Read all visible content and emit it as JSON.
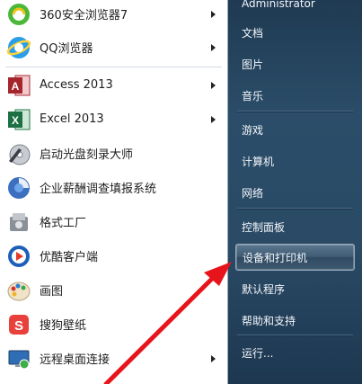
{
  "start_menu": {
    "programs": [
      {
        "label": "360安全浏览器7",
        "icon": "360-browser-icon",
        "has_arrow": true
      },
      {
        "label": "QQ浏览器",
        "icon": "qq-browser-icon",
        "has_arrow": true
      },
      {
        "label": "Access 2013",
        "icon": "access-icon",
        "has_arrow": true
      },
      {
        "label": "Excel 2013",
        "icon": "excel-icon",
        "has_arrow": true
      },
      {
        "label": "启动光盘刻录大师",
        "icon": "disc-burner-icon",
        "has_arrow": false
      },
      {
        "label": "企业薪酬调查填报系统",
        "icon": "survey-system-icon",
        "has_arrow": false
      },
      {
        "label": "格式工厂",
        "icon": "format-factory-icon",
        "has_arrow": false
      },
      {
        "label": "优酷客户端",
        "icon": "youku-icon",
        "has_arrow": false
      },
      {
        "label": "画图",
        "icon": "paint-icon",
        "has_arrow": false
      },
      {
        "label": "搜狗壁纸",
        "icon": "sogou-wallpaper-icon",
        "has_arrow": false
      },
      {
        "label": "远程桌面连接",
        "icon": "remote-desktop-icon",
        "has_arrow": true
      }
    ],
    "places": {
      "user": "Administrator",
      "documents": "文档",
      "pictures": "图片",
      "music": "音乐",
      "games": "游戏",
      "computer": "计算机",
      "network": "网络",
      "control_panel": "控制面板",
      "devices_printers": "设备和打印机",
      "default_programs": "默认程序",
      "help": "帮助和支持",
      "run": "运行..."
    },
    "colors": {
      "highlight": "#3f5b73",
      "annotation_arrow": "#e8141b"
    }
  }
}
